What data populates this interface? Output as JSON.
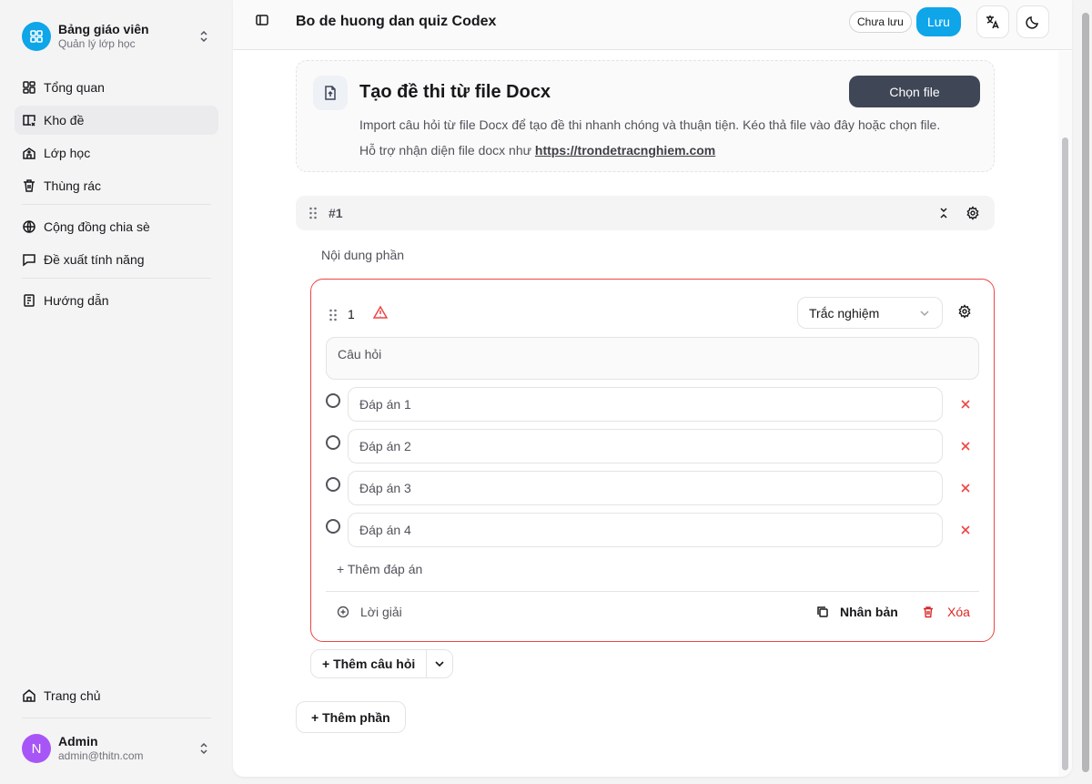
{
  "sidebar": {
    "brand_title": "Bảng giáo viên",
    "brand_subtitle": "Quản lý lớp học",
    "nav": [
      {
        "label": "Tổng quan",
        "icon": "dashboard-icon"
      },
      {
        "label": "Kho đề",
        "icon": "book-icon",
        "active": true
      },
      {
        "label": "Lớp học",
        "icon": "school-icon"
      },
      {
        "label": "Thùng rác",
        "icon": "trash-icon"
      }
    ],
    "nav2": [
      {
        "label": "Cộng đồng chia sè",
        "icon": "globe-icon"
      },
      {
        "label": "Đề xuất tính năng",
        "icon": "message-icon"
      }
    ],
    "nav3": [
      {
        "label": "Hướng dẫn",
        "icon": "guide-icon"
      }
    ],
    "home_label": "Trang chủ",
    "user": {
      "initial": "N",
      "name": "Admin",
      "email": "admin@thitn.com"
    }
  },
  "header": {
    "title": "Bo de huong dan quiz Codex",
    "status": "Chưa lưu",
    "save_label": "Lưu"
  },
  "import": {
    "title": "Tạo đề thi từ file Docx",
    "button": "Chọn file",
    "description": "Import câu hỏi từ file Docx để tạo đề thi nhanh chóng và thuận tiện. Kéo thả file vào đây hoặc chọn file.",
    "support_prefix": "Hỗ trợ nhận diện file docx như ",
    "support_link": "https://trondetracnghiem.com"
  },
  "section": {
    "number": "#1",
    "content_placeholder": "Nội dung phần"
  },
  "question": {
    "number": "1",
    "type": "Trắc nghiệm",
    "placeholder": "Câu hỏi",
    "answers": [
      "Đáp án 1",
      "Đáp án 2",
      "Đáp án 3",
      "Đáp án 4"
    ],
    "add_answer": "+ Thêm đáp án",
    "solution": "Lời giải",
    "duplicate": "Nhân bản",
    "delete": "Xóa"
  },
  "actions": {
    "add_question": "+ Thêm câu hỏi",
    "add_section": "+ Thêm phần"
  },
  "colors": {
    "accent": "#0ea5e9",
    "danger": "#ef4444",
    "dark_button": "#3f4656",
    "avatar": "#a855f7"
  }
}
